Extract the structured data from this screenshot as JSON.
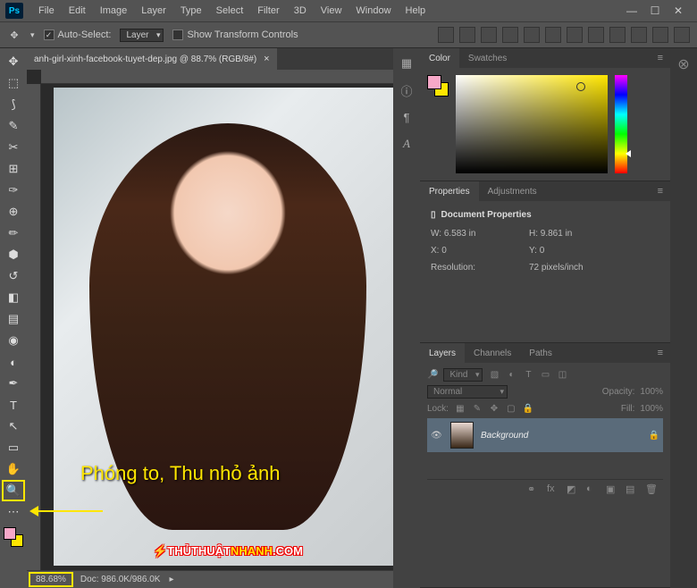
{
  "menus": [
    "File",
    "Edit",
    "Image",
    "Layer",
    "Type",
    "Select",
    "Filter",
    "3D",
    "View",
    "Window",
    "Help"
  ],
  "optbar": {
    "autoSelect": "Auto-Select:",
    "layerSel": "Layer",
    "showTransform": "Show Transform Controls"
  },
  "tab": {
    "title": "anh-girl-xinh-facebook-tuyet-dep.jpg @ 88.7% (RGB/8#)"
  },
  "annotation": "Phóng to, Thu nhỏ ảnh",
  "watermarkA": "THỦTHUẬT",
  "watermarkB": "NHANH",
  "watermarkC": ".COM",
  "status": {
    "zoom": "88.68%",
    "doc": "Doc: 986.0K/986.0K"
  },
  "colorTabs": {
    "a": "Color",
    "b": "Swatches"
  },
  "propsTabs": {
    "a": "Properties",
    "b": "Adjustments"
  },
  "props": {
    "heading": "Document Properties",
    "wLabel": "W:",
    "w": "6.583 in",
    "hLabel": "H:",
    "h": "9.861 in",
    "xLabel": "X:",
    "x": "0",
    "yLabel": "Y:",
    "y": "0",
    "resLabel": "Resolution:",
    "res": "72 pixels/inch"
  },
  "layersTabs": {
    "a": "Layers",
    "b": "Channels",
    "c": "Paths"
  },
  "layers": {
    "kind": "Kind",
    "blend": "Normal",
    "opacityLabel": "Opacity:",
    "opacity": "100%",
    "lockLabel": "Lock:",
    "fillLabel": "Fill:",
    "fill": "100%",
    "bgName": "Background"
  }
}
